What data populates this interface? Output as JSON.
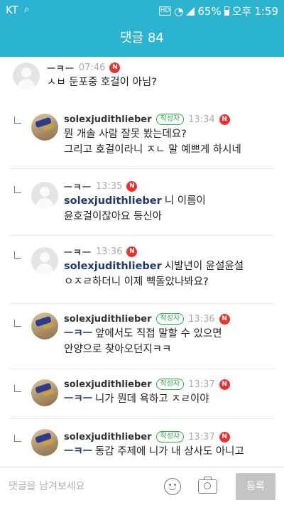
{
  "status_bar": {
    "carrier": "KT",
    "battery": "65%",
    "ampm": "오후",
    "time": "1:59",
    "hd_label": "HD"
  },
  "header": {
    "title": "댓글 84"
  },
  "new_badge": "N",
  "author_badge": "작성자",
  "comments": [
    {
      "nickname": "ㅡㅋㅡ",
      "time": "07:46",
      "mention": "",
      "text": "ㅅㅂ 둔포중 호걸이 아님?"
    },
    {
      "nickname": "solexjudithlieber",
      "time": "13:34",
      "mention": "",
      "text": "뭔 개솔 사람 잘못 봤는데요?\n그리고 호걸이라니 ㅈㄴ 말 예쁘게 하시네"
    },
    {
      "nickname": "ㅡㅋㅡ",
      "time": "13:35",
      "mention": "solexjudithlieber",
      "text": "니 이름이\n윤호걸이잖아요 등신아"
    },
    {
      "nickname": "ㅡㅋㅡ",
      "time": "13:36",
      "mention": "solexjudithlieber",
      "text": "시발년이 윤설윤설\nㅇㅈㄹ하더니 이제 삑돌았나봐요?"
    },
    {
      "nickname": "solexjudithlieber",
      "time": "13:36",
      "mention": "ㅡㅋㅡ",
      "text": "앞에서도 직접 말할 수 있으면\n안양으로 찾아오던지ㅋㅋ"
    },
    {
      "nickname": "solexjudithlieber",
      "time": "13:37",
      "mention": "ㅡㅋㅡ",
      "text": "니가 뭔데 욕하고 ㅈㄹ이야"
    },
    {
      "nickname": "solexjudithlieber",
      "time": "13:37",
      "mention": "ㅡㅋㅡ",
      "text": "동갑 주제에 니가 내 상사도 아니고"
    }
  ],
  "input": {
    "placeholder": "댓글을 남겨보세요",
    "submit_label": "등록"
  },
  "icons": {
    "search": "search-icon",
    "wifi": "wifi-icon",
    "signal": "signal-icon",
    "battery": "battery-icon",
    "reply": "reply-arrow-icon",
    "emoji": "emoji-icon",
    "camera": "camera-icon"
  },
  "colors": {
    "header_bg": "#2bb3cf",
    "new_badge": "#e8322d",
    "author_badge": "#2aa84a"
  }
}
